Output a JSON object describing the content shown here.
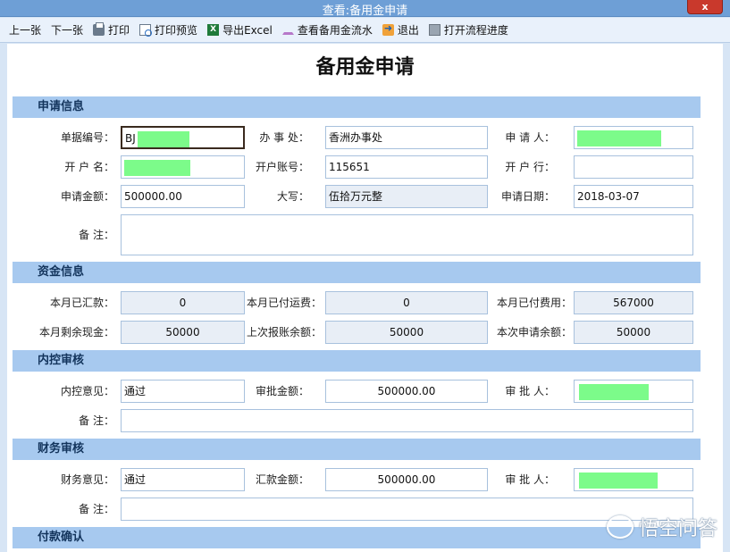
{
  "window": {
    "title": "查看:备用金申请",
    "close_label": "x"
  },
  "toolbar": {
    "items": [
      {
        "label": "上一张",
        "icon": ""
      },
      {
        "label": "下一张",
        "icon": ""
      },
      {
        "label": "打印",
        "icon": "print-icon"
      },
      {
        "label": "打印预览",
        "icon": "print-preview-icon"
      },
      {
        "label": "导出Excel",
        "icon": "excel-icon"
      },
      {
        "label": "查看备用金流水",
        "icon": "cart-icon"
      },
      {
        "label": "退出",
        "icon": "exit-icon"
      },
      {
        "label": "打开流程进度",
        "icon": "flow-icon"
      }
    ],
    "excel_icon_text": "X"
  },
  "doc": {
    "title": "备用金申请"
  },
  "sections": {
    "apply_info": "申请信息",
    "fund_info": "资金信息",
    "internal_review": "内控审核",
    "finance_review": "财务审核",
    "payment_confirm": "付款确认"
  },
  "apply": {
    "doc_no_label": "单据编号：",
    "doc_no_value": "BJ",
    "office_label": "办 事 处：",
    "office_value": "香洲办事处",
    "applicant_label": "申 请 人：",
    "applicant_value": "",
    "account_name_label": "开 户 名：",
    "account_name_value": "",
    "account_no_label": "开户账号：",
    "account_no_value": "115651",
    "bank_label": "开 户 行：",
    "bank_value": "",
    "amount_label": "申请金额：",
    "amount_value": "500000.00",
    "amount_upper_label": "大写：",
    "amount_upper_value": "伍拾万元整",
    "date_label": "申请日期：",
    "date_value": "2018-03-07",
    "remark_label": "备    注：",
    "remark_value": ""
  },
  "fund": {
    "remit_label": "本月已汇款：",
    "remit_value": "0",
    "freight_label": "本月已付运费：",
    "freight_value": "0",
    "expense_label": "本月已付费用：",
    "expense_value": "567000",
    "cash_left_label": "本月剩余现金：",
    "cash_left_value": "50000",
    "last_balance_label": "上次报账余额：",
    "last_balance_value": "50000",
    "apply_balance_label": "本次申请余额：",
    "apply_balance_value": "50000"
  },
  "internal": {
    "opinion_label": "内控意见：",
    "opinion_value": "通过",
    "approved_amount_label": "审批金额：",
    "approved_amount_value": "500000.00",
    "approver_label": "审 批 人：",
    "approver_value": "",
    "remark_label": "备    注：",
    "remark_value": ""
  },
  "finance": {
    "opinion_label": "财务意见：",
    "opinion_value": "通过",
    "remit_amount_label": "汇款金额：",
    "remit_amount_value": "500000.00",
    "approver_label": "审 批 人：",
    "approver_value": "",
    "remark_label": "备    注：",
    "remark_value": ""
  },
  "watermark": {
    "text": "悟空问答"
  },
  "colors": {
    "title_bar": "#6e9fd6",
    "close_button": "#c9392c",
    "section_header": "#a7c9ef",
    "redaction": "#7cfb8a",
    "readonly_field": "#e8eef6"
  }
}
